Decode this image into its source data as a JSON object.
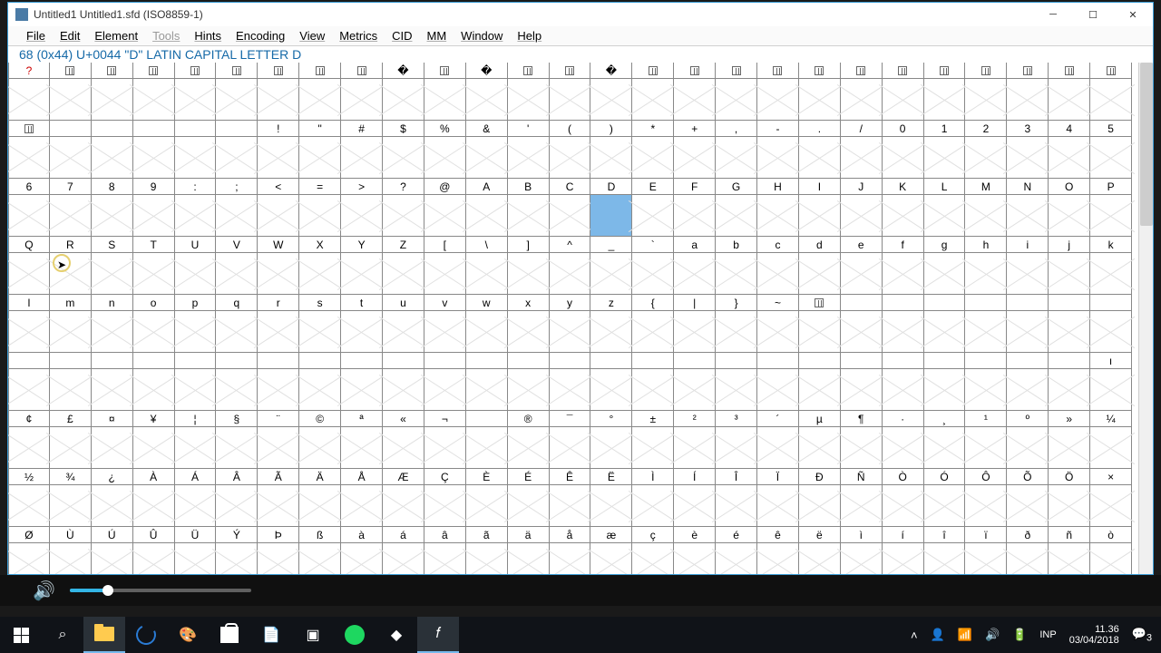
{
  "window": {
    "title": "Untitled1  Untitled1.sfd (ISO8859-1)"
  },
  "menu": [
    "File",
    "Edit",
    "Element",
    "Tools",
    "Hints",
    "Encoding",
    "View",
    "Metrics",
    "CID",
    "MM",
    "Window",
    "Help"
  ],
  "menu_disabled_idx": 3,
  "info": "68 (0x44) U+0044 \"D\" LATIN CAPITAL LETTER D",
  "selected_char": "D",
  "grid": {
    "cols": 27,
    "rows": [
      {
        "headers": [
          "?",
          "▯",
          "▯",
          "▯",
          "▯",
          "▯",
          "▯",
          "▯",
          "▯",
          "�",
          "▯",
          "�",
          "▯",
          "▯",
          "�",
          "▯",
          "▯",
          "▯",
          "▯",
          "▯",
          "▯",
          "▯",
          "▯",
          "▯",
          "▯",
          "▯",
          "▯"
        ],
        "first_red": true
      },
      {
        "headers": [
          "▯",
          "",
          "",
          "",
          "",
          "",
          "!",
          "\"",
          "#",
          "$",
          "%",
          "&",
          "'",
          "(",
          ")",
          "*",
          "+",
          ",",
          "-",
          ".",
          "/",
          "0",
          "1",
          "2",
          "3",
          "4",
          "5"
        ]
      },
      {
        "headers": [
          "6",
          "7",
          "8",
          "9",
          ":",
          ";",
          "<",
          "=",
          ">",
          "?",
          "@",
          "A",
          "B",
          "C",
          "D",
          "E",
          "F",
          "G",
          "H",
          "I",
          "J",
          "K",
          "L",
          "M",
          "N",
          "O",
          "P"
        ]
      },
      {
        "headers": [
          "Q",
          "R",
          "S",
          "T",
          "U",
          "V",
          "W",
          "X",
          "Y",
          "Z",
          "[",
          "\\",
          "]",
          "^",
          "_",
          "`",
          "a",
          "b",
          "c",
          "d",
          "e",
          "f",
          "g",
          "h",
          "i",
          "j",
          "k"
        ]
      },
      {
        "headers": [
          "l",
          "m",
          "n",
          "o",
          "p",
          "q",
          "r",
          "s",
          "t",
          "u",
          "v",
          "w",
          "x",
          "y",
          "z",
          "{",
          "|",
          "}",
          "~",
          "▯",
          "",
          "",
          "",
          "",
          "",
          "",
          ""
        ]
      },
      {
        "headers": [
          "",
          "",
          "",
          "",
          "",
          "",
          "",
          "",
          "",
          "",
          "",
          "",
          "",
          "",
          "",
          "",
          "",
          "",
          "",
          "",
          "",
          "",
          "",
          "",
          "",
          "",
          "ı"
        ]
      },
      {
        "headers": [
          "¢",
          "£",
          "¤",
          "¥",
          "¦",
          "§",
          "¨",
          "©",
          "ª",
          "«",
          "¬",
          "­",
          "®",
          "¯",
          "°",
          "±",
          "²",
          "³",
          "´",
          "µ",
          "¶",
          "·",
          "¸",
          "¹",
          "º",
          "»",
          "¼"
        ]
      },
      {
        "headers": [
          "½",
          "¾",
          "¿",
          "À",
          "Á",
          "Â",
          "Ã",
          "Ä",
          "Å",
          "Æ",
          "Ç",
          "È",
          "É",
          "Ê",
          "Ë",
          "Ì",
          "Í",
          "Î",
          "Ï",
          "Ð",
          "Ñ",
          "Ò",
          "Ó",
          "Ô",
          "Õ",
          "Ö",
          "×"
        ]
      },
      {
        "headers": [
          "Ø",
          "Ù",
          "Ú",
          "Û",
          "Ü",
          "Ý",
          "Þ",
          "ß",
          "à",
          "á",
          "â",
          "ã",
          "ä",
          "å",
          "æ",
          "ç",
          "è",
          "é",
          "ê",
          "ë",
          "ì",
          "í",
          "î",
          "ï",
          "ð",
          "ñ",
          "ò"
        ]
      }
    ]
  },
  "taskbar": {
    "tray": {
      "lang": "INP",
      "time": "11.36",
      "date": "03/04/2018",
      "notif": "3"
    }
  }
}
